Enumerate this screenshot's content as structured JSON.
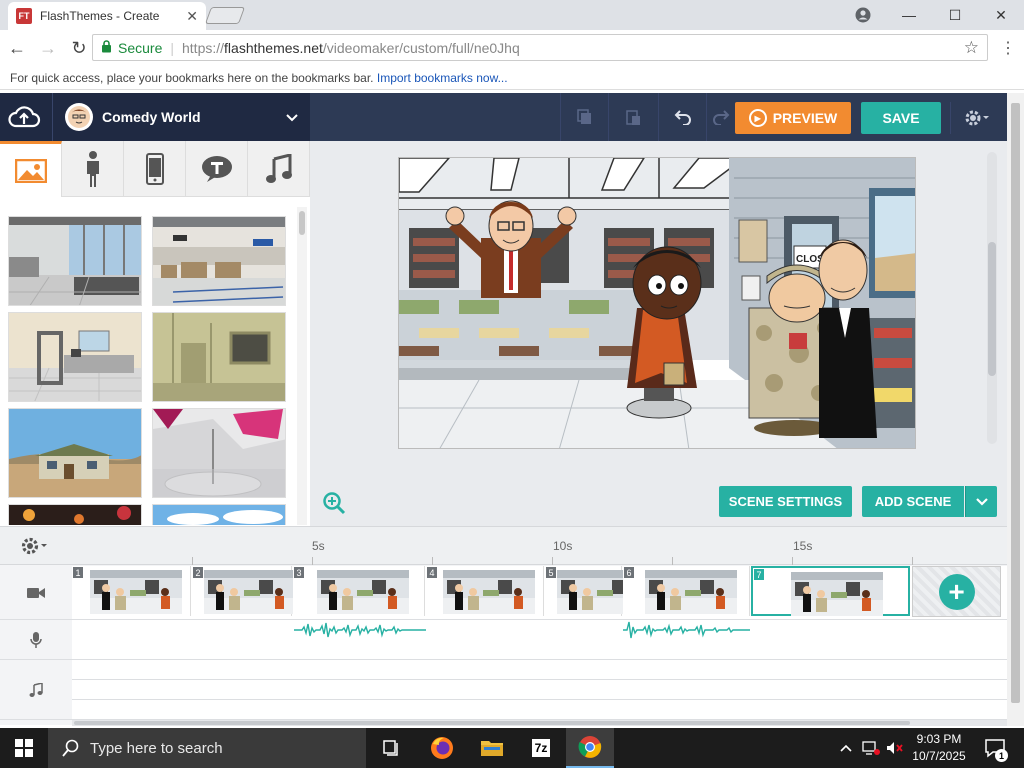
{
  "browser": {
    "tab_title": "FlashThemes - Create",
    "favicon_text": "FT",
    "close_tab": "✕",
    "nav": {
      "back": "←",
      "forward": "→",
      "reload": "↻"
    },
    "address": {
      "security_label": "Secure",
      "url_prefix": "https://",
      "url_host": "flashthemes.net",
      "url_path": "/videomaker/custom/full/ne0Jhq"
    },
    "bookmarks_prompt": "For quick access, place your bookmarks here on the bookmarks bar.",
    "bookmarks_link": "Import bookmarks now...",
    "window_controls": {
      "minimize": "—",
      "maximize": "☐",
      "close": "✕"
    }
  },
  "app": {
    "theme_name": "Comedy World",
    "preview_label": "PREVIEW",
    "save_label": "SAVE",
    "colors": {
      "header": "#2d3a55",
      "accent_orange": "#f28b30",
      "accent_teal": "#27b1a3"
    }
  },
  "library": {
    "tabs": [
      {
        "name": "backgrounds",
        "icon": "image-icon",
        "active": true
      },
      {
        "name": "characters",
        "icon": "person-icon",
        "active": false
      },
      {
        "name": "props",
        "icon": "phone-icon",
        "active": false
      },
      {
        "name": "text",
        "icon": "speech-bubble-icon",
        "active": false
      },
      {
        "name": "audio",
        "icon": "music-note-icon",
        "active": false
      }
    ]
  },
  "stage": {
    "scene_settings_label": "SCENE SETTINGS",
    "add_scene_label": "ADD SCENE",
    "sign_text": "CLOSE"
  },
  "timeline": {
    "time_markers": [
      "5s",
      "10s",
      "15s"
    ],
    "scenes": [
      {
        "number": "1"
      },
      {
        "number": "2"
      },
      {
        "number": "3"
      },
      {
        "number": "4"
      },
      {
        "number": "5"
      },
      {
        "number": "6"
      },
      {
        "number": "7",
        "active": true
      }
    ]
  },
  "taskbar": {
    "search_placeholder": "Type here to search",
    "archiver_label": "7z",
    "time": "9:03 PM",
    "date": "10/7/2025",
    "notification_count": "1"
  }
}
